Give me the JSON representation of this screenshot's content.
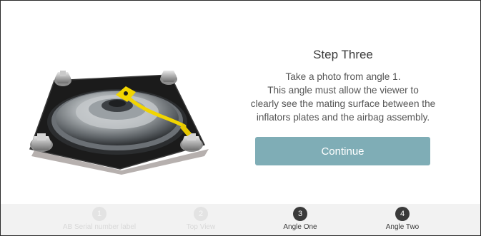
{
  "step": {
    "title": "Step Three",
    "description_lines": [
      "Take a photo from angle 1.",
      "This angle must allow the viewer to",
      "clearly see the mating surface between the",
      "inflators plates and the airbag assembly."
    ],
    "continue_label": "Continue"
  },
  "stepper": [
    {
      "number": "1",
      "label": "AB Serial number label",
      "state": "completed"
    },
    {
      "number": "2",
      "label": "Top View",
      "state": "completed"
    },
    {
      "number": "3",
      "label": "Angle One",
      "state": "current"
    },
    {
      "number": "4",
      "label": "Angle Two",
      "state": "upcoming"
    }
  ],
  "image": {
    "subject": "airbag-inflator-assembly",
    "tag_color": "#f2d500",
    "plate_color": "#1a1a1a",
    "dome_color": "#9ea3a6"
  },
  "colors": {
    "accent": "#7fadb6",
    "stepper_bg": "#f2f2f2",
    "step_active": "#3a3a3a",
    "step_done": "#e3e3e3"
  }
}
